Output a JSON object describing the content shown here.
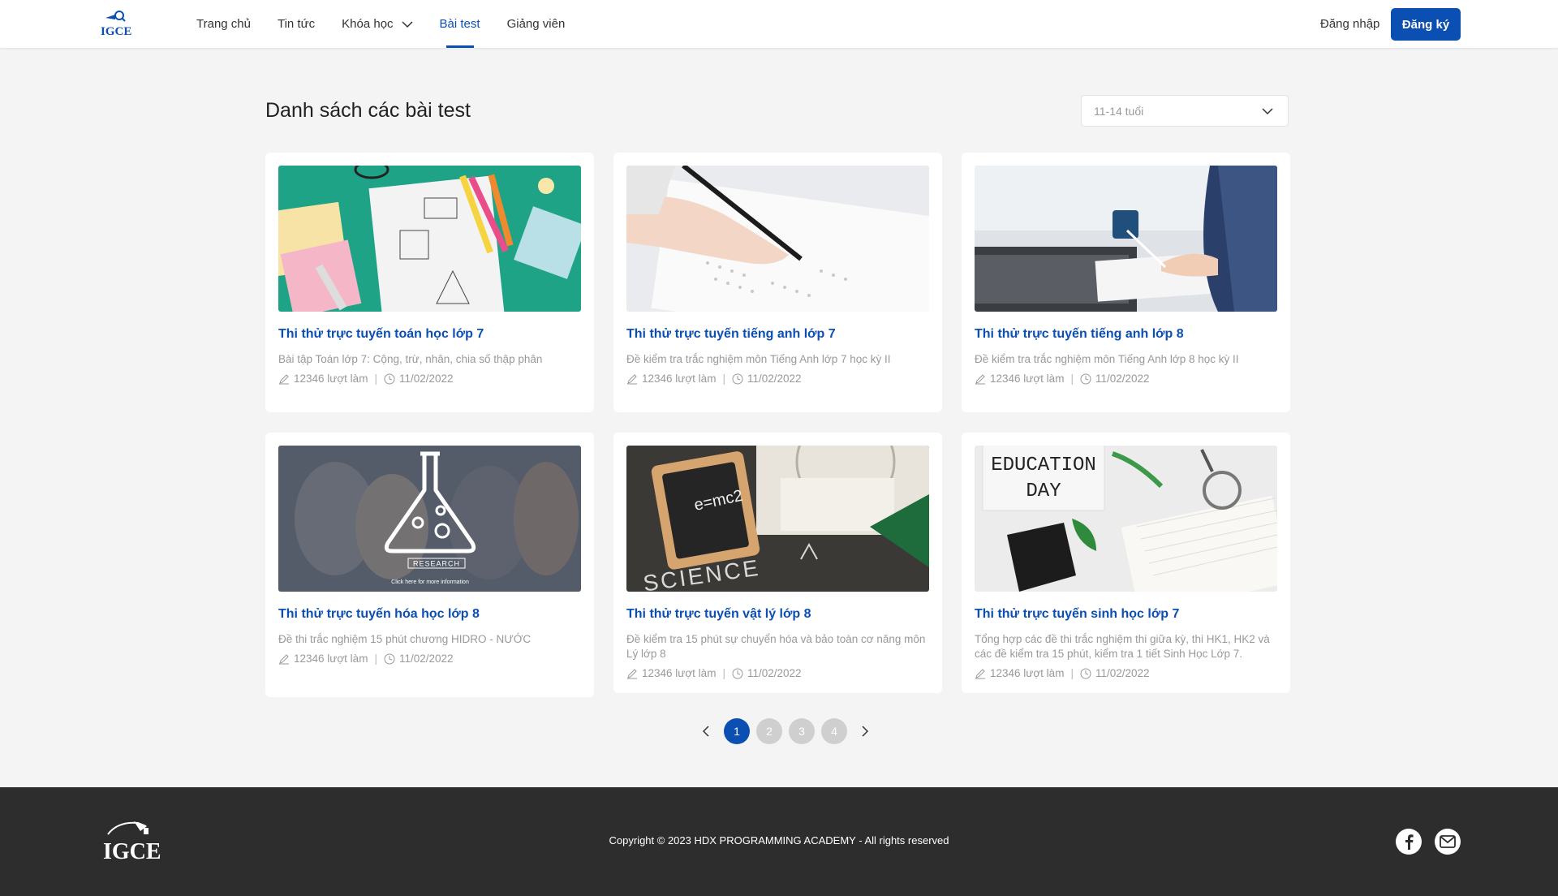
{
  "header": {
    "logo_text": "IGCE",
    "nav": [
      {
        "label": "Trang chủ"
      },
      {
        "label": "Tin tức"
      },
      {
        "label": "Khóa học"
      },
      {
        "label": "Bài test"
      },
      {
        "label": "Giảng viên"
      }
    ],
    "login_label": "Đăng nhập",
    "register_label": "Đăng ký"
  },
  "main": {
    "title": "Danh sách các bài test",
    "age_filter": "11-14 tuổi",
    "tests": [
      {
        "title": "Thi thử trực tuyến toán học lớp 7",
        "desc": "Bài tập Toán lớp 7: Cộng, trừ, nhân, chia số thập phân",
        "attempts": "12346 lượt làm",
        "date": "11/02/2022"
      },
      {
        "title": "Thi thử trực tuyến tiếng anh lớp 7",
        "desc": "Đề kiểm tra trắc nghiệm môn Tiếng Anh lớp 7 học kỳ II",
        "attempts": "12346 lượt làm",
        "date": "11/02/2022"
      },
      {
        "title": "Thi thử trực tuyến tiếng anh lớp 8",
        "desc": "Đề kiểm tra trắc nghiệm môn Tiếng Anh lớp 8 học kỳ II",
        "attempts": "12346 lượt làm",
        "date": "11/02/2022"
      },
      {
        "title": "Thi thử trực tuyến hóa học lớp 8",
        "desc": "Đề thi trắc nghiệm 15 phút chương HIDRO - NƯỚC",
        "attempts": "12346 lượt làm",
        "date": "11/02/2022"
      },
      {
        "title": "Thi thử trực tuyến vật lý lớp 8",
        "desc": "Đề kiểm tra 15 phút sự chuyển hóa và bảo toàn cơ năng môn Lý lớp 8",
        "attempts": "12346 lượt làm",
        "date": "11/02/2022"
      },
      {
        "title": "Thi thử trực tuyến sinh học lớp 7",
        "desc": "Tổng hợp các đề thi trắc nghiệm thi giữa kỳ, thi HK1, HK2 và các đề kiểm tra 15 phút, kiểm tra 1 tiết Sinh Học Lớp 7.",
        "attempts": "12346 lượt làm",
        "date": "11/02/2022"
      }
    ],
    "image_texts": {
      "research": "RESEARCH",
      "research_sub": "Click here for more information",
      "emc2": "e=mc2",
      "science": "SCIENCE",
      "education": "EDUCATION",
      "day": "DAY"
    }
  },
  "pagination": {
    "pages": [
      "1",
      "2",
      "3",
      "4"
    ],
    "current": "1"
  },
  "footer": {
    "logo_text": "IGCE",
    "copyright": "Copyright © 2023 HDX PROGRAMMING ACADEMY - All rights reserved"
  },
  "colors": {
    "brand": "#0b4fb3",
    "footer_bg": "#2d2d2d",
    "page_bg": "#f4f4f4"
  }
}
